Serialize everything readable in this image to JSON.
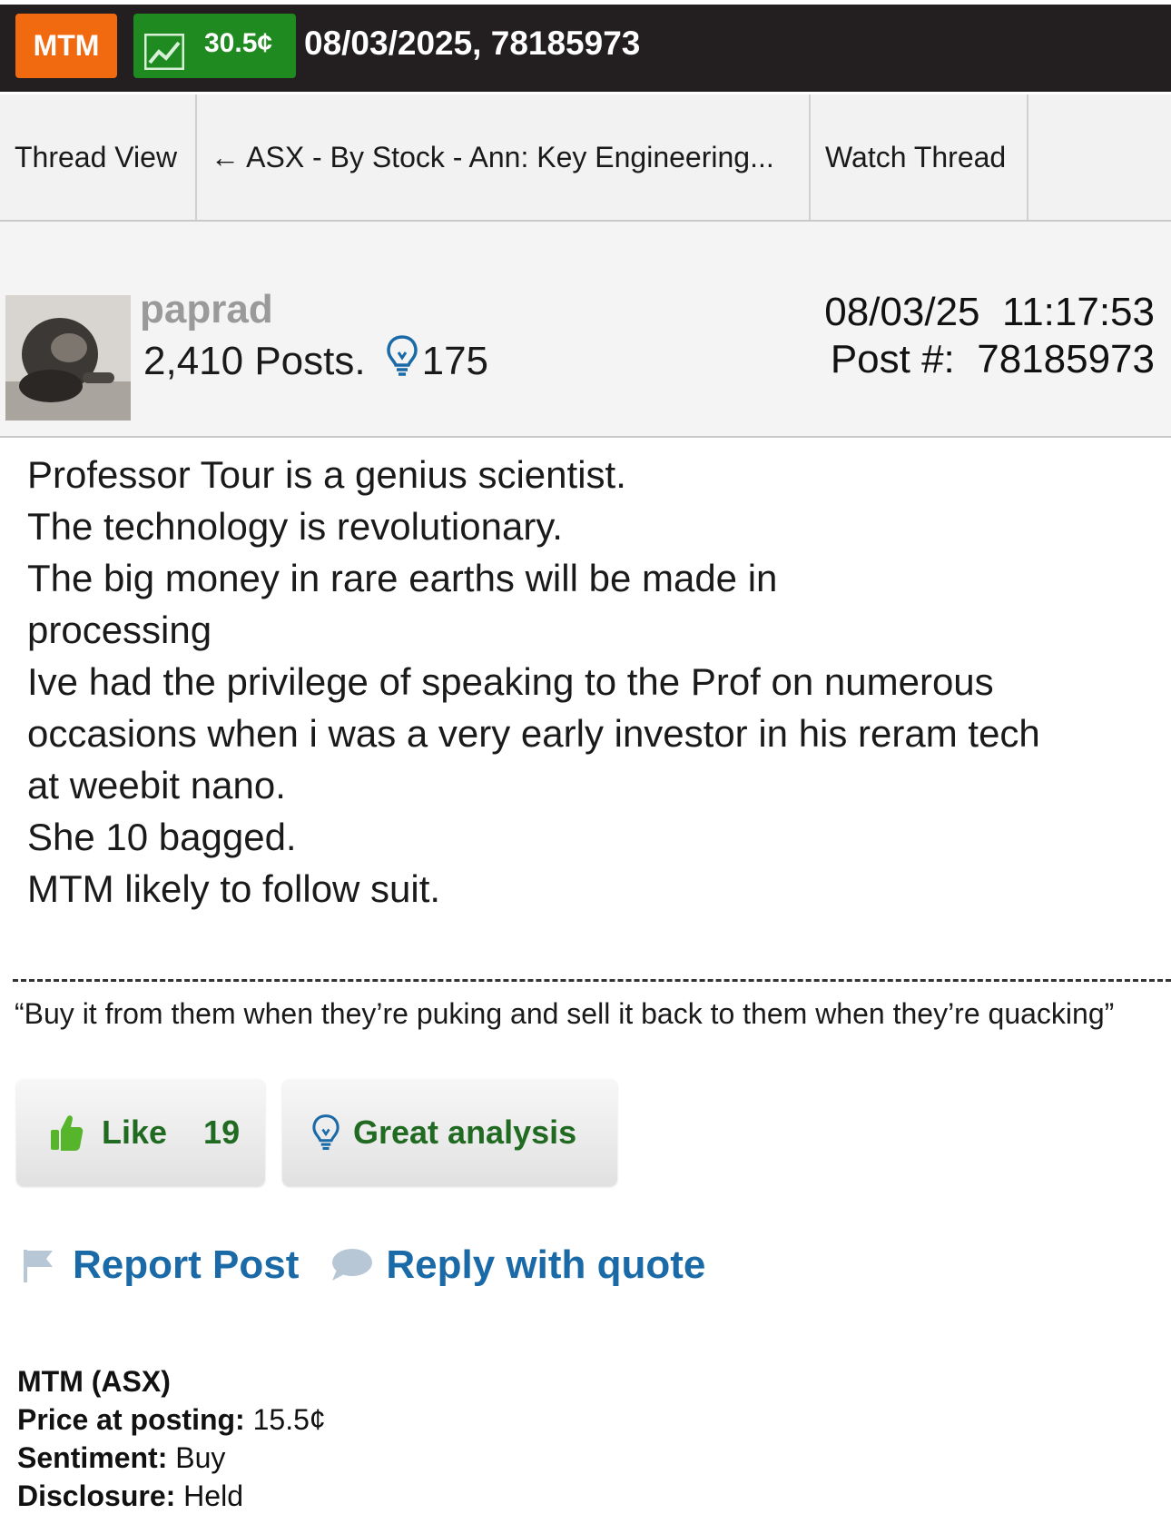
{
  "topbar": {
    "ticker": "MTM",
    "price": "30.5¢",
    "meta": "08/03/2025, 78185973",
    "colors": {
      "ticker_bg": "#f26a10",
      "price_bg": "#1f8a1f",
      "bar_bg": "#231f20"
    }
  },
  "tabs": [
    {
      "label": "Thread View"
    },
    {
      "label": "← ASX - By Stock - Ann: Key Engineering..."
    },
    {
      "label": "Watch Thread"
    }
  ],
  "post": {
    "username": "paprad",
    "posts": "2,410 Posts.",
    "lightbulbs": "175",
    "date": "08/03/25",
    "time": "11:17:53",
    "post_number_label": "Post #:",
    "post_number": "78185973",
    "body_lines": [
      "Professor Tour is a genius scientist.",
      "The technology is revolutionary.",
      "The big money in rare earths will be made in",
      "processing",
      "Ive had the privilege of speaking to the Prof on numerous",
      "occasions when i was a very early investor in his reram tech",
      "at weebit nano.",
      "She 10 bagged.",
      "MTM likely to follow suit."
    ],
    "signature": "“Buy it from them when they’re puking and sell it back to them when they’re quacking”"
  },
  "reactions": {
    "like_label": "Like",
    "like_count": "19",
    "great_label": "Great analysis"
  },
  "actions": {
    "report": "Report Post",
    "reply": "Reply with quote"
  },
  "info": {
    "stock": "MTM (ASX)",
    "price_label": "Price at posting:",
    "price_value": "15.5¢",
    "sentiment_label": "Sentiment:",
    "sentiment_value": "Buy",
    "disclosure_label": "Disclosure:",
    "disclosure_value": "Held"
  },
  "icons": [
    "chart-icon",
    "lightbulb-icon",
    "thumbs-up-icon",
    "flag-icon",
    "speech-bubble-icon"
  ]
}
